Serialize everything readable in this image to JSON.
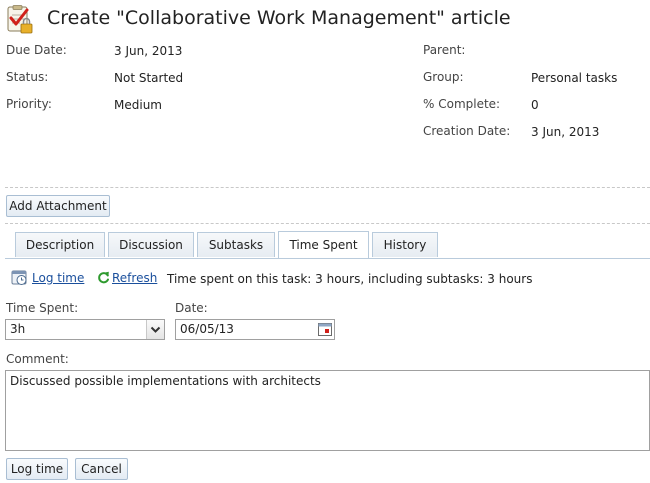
{
  "header": {
    "title": "Create \"Collaborative Work Management\" article",
    "icon": "task-checklist-lock-icon"
  },
  "details_left": [
    {
      "label": "Due Date:",
      "value": "3 Jun, 2013"
    },
    {
      "label": "Status:",
      "value": "Not Started"
    },
    {
      "label": "Priority:",
      "value": "Medium"
    }
  ],
  "details_right": [
    {
      "label": "Parent:",
      "value": ""
    },
    {
      "label": "Group:",
      "value": "Personal tasks"
    },
    {
      "label": "% Complete:",
      "value": "0"
    },
    {
      "label": "Creation Date:",
      "value": "3 Jun, 2013"
    }
  ],
  "attachment": {
    "button_label": "Add Attachment"
  },
  "tabs": [
    {
      "label": "Description",
      "active": false
    },
    {
      "label": "Discussion",
      "active": false
    },
    {
      "label": "Subtasks",
      "active": false
    },
    {
      "label": "Time Spent",
      "active": true
    },
    {
      "label": "History",
      "active": false
    }
  ],
  "time_spent": {
    "log_time_link": "Log time",
    "refresh_link": "Refresh",
    "summary": "Time spent on this task: 3 hours, including subtasks: 3 hours",
    "time_spent_label": "Time Spent:",
    "time_spent_value": "3h",
    "date_label": "Date:",
    "date_value": "06/05/13",
    "comment_label": "Comment:",
    "comment_value": "Discussed possible implementations with architects",
    "log_time_button": "Log time",
    "cancel_button": "Cancel"
  },
  "colors": {
    "link": "#1a4f9c",
    "tab_border": "#b9cbdc",
    "button_border": "#a9bed3",
    "refresh_green": "#2e9a2e"
  }
}
